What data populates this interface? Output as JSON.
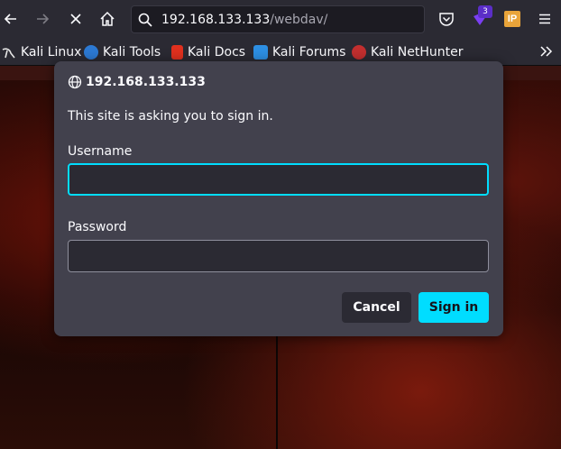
{
  "toolbar": {
    "url_host": "192.168.133.133",
    "url_path": "/webdav/",
    "extension_badge": "3",
    "ip_extension_label": "IP"
  },
  "bookmarks": [
    {
      "label": "Kali Linux",
      "icon": "kali-dragon-icon",
      "color": "#367bf0"
    },
    {
      "label": "Kali Tools",
      "icon": "kali-tools-icon",
      "color": "#2c79d3"
    },
    {
      "label": "Kali Docs",
      "icon": "kali-docs-icon",
      "color": "#e0301e"
    },
    {
      "label": "Kali Forums",
      "icon": "kali-forums-icon",
      "color": "#2d8fe3"
    },
    {
      "label": "Kali NetHunter",
      "icon": "kali-nethunter-icon",
      "color": "#c22f2f"
    }
  ],
  "dialog": {
    "host": "192.168.133.133",
    "message": "This site is asking you to sign in.",
    "username_label": "Username",
    "username_value": "",
    "password_label": "Password",
    "password_value": "",
    "cancel_label": "Cancel",
    "signin_label": "Sign in"
  },
  "colors": {
    "accent": "#00ddff",
    "toolbar_bg": "#2b2a33",
    "dialog_bg": "#42414d"
  }
}
